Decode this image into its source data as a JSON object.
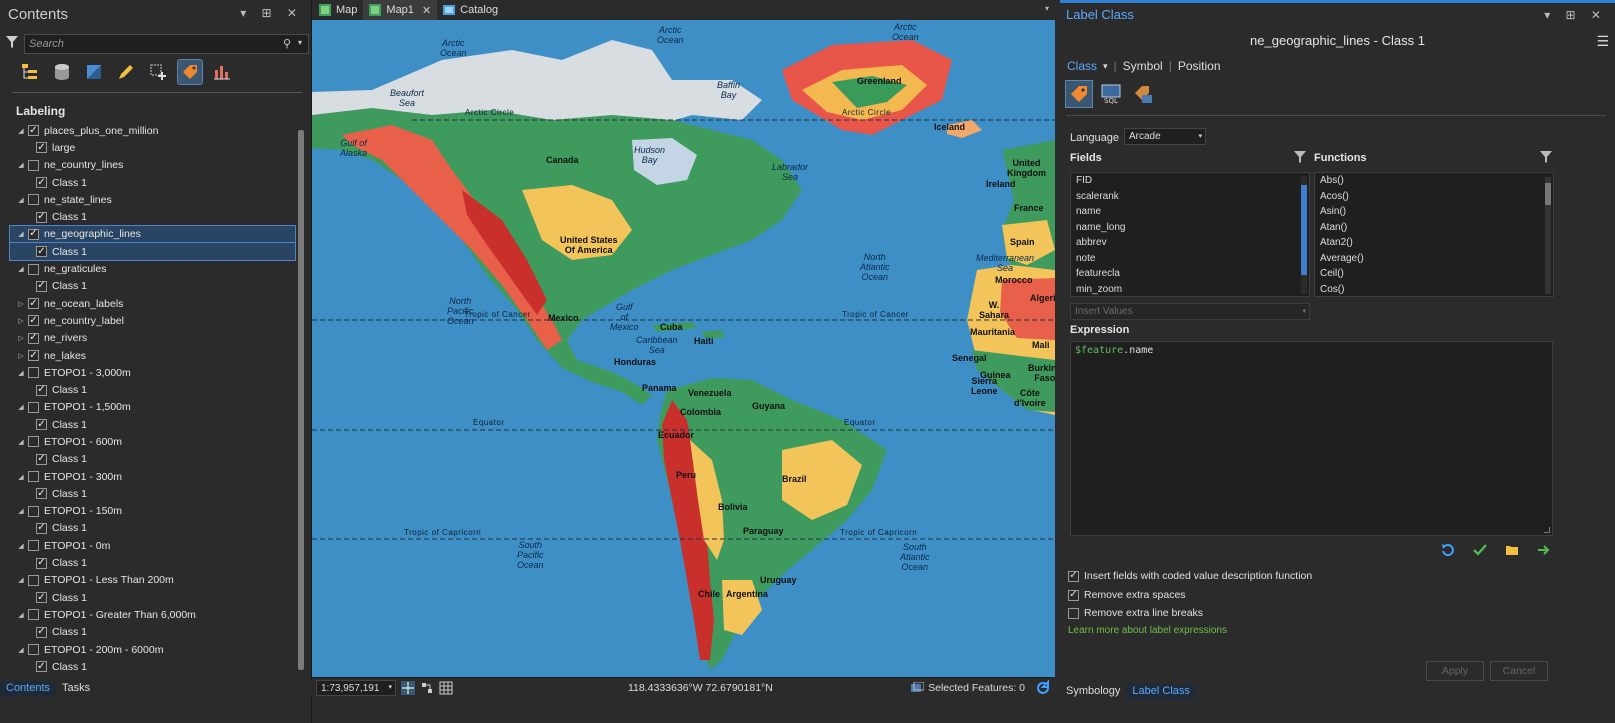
{
  "contents": {
    "title": "Contents",
    "title_controls": "▾ ⊞ ✕",
    "search_placeholder": "Search",
    "section": "Labeling",
    "layers": [
      {
        "type": "parent",
        "label": "places_plus_one_million",
        "checked": true,
        "expanded": true
      },
      {
        "type": "child",
        "label": "large",
        "checked": true
      },
      {
        "type": "parent",
        "label": "ne_country_lines",
        "checked": false,
        "expanded": true
      },
      {
        "type": "child",
        "label": "Class 1",
        "checked": true
      },
      {
        "type": "parent",
        "label": "ne_state_lines",
        "checked": false,
        "expanded": true
      },
      {
        "type": "child",
        "label": "Class 1",
        "checked": true
      },
      {
        "type": "parent",
        "label": "ne_geographic_lines",
        "checked": true,
        "expanded": true,
        "selected": true
      },
      {
        "type": "child",
        "label": "Class 1",
        "checked": true,
        "selected": true
      },
      {
        "type": "parent",
        "label": "ne_graticules",
        "checked": false,
        "expanded": true
      },
      {
        "type": "child",
        "label": "Class 1",
        "checked": true
      },
      {
        "type": "parent",
        "label": "ne_ocean_labels",
        "checked": true,
        "expanded": false
      },
      {
        "type": "parent",
        "label": "ne_country_label",
        "checked": true,
        "expanded": false
      },
      {
        "type": "parent",
        "label": "ne_rivers",
        "checked": true,
        "expanded": false
      },
      {
        "type": "parent",
        "label": "ne_lakes",
        "checked": true,
        "expanded": false
      },
      {
        "type": "parent",
        "label": "ETOPO1 - 3,000m",
        "checked": false,
        "expanded": true
      },
      {
        "type": "child",
        "label": "Class 1",
        "checked": true
      },
      {
        "type": "parent",
        "label": "ETOPO1 - 1,500m",
        "checked": false,
        "expanded": true
      },
      {
        "type": "child",
        "label": "Class 1",
        "checked": true
      },
      {
        "type": "parent",
        "label": "ETOPO1 - 600m",
        "checked": false,
        "expanded": true
      },
      {
        "type": "child",
        "label": "Class 1",
        "checked": true
      },
      {
        "type": "parent",
        "label": "ETOPO1 - 300m",
        "checked": false,
        "expanded": true
      },
      {
        "type": "child",
        "label": "Class 1",
        "checked": true
      },
      {
        "type": "parent",
        "label": "ETOPO1 - 150m",
        "checked": false,
        "expanded": true
      },
      {
        "type": "child",
        "label": "Class 1",
        "checked": true
      },
      {
        "type": "parent",
        "label": "ETOPO1 - 0m",
        "checked": false,
        "expanded": true
      },
      {
        "type": "child",
        "label": "Class 1",
        "checked": true
      },
      {
        "type": "parent",
        "label": "ETOPO1 - Less Than 200m",
        "checked": false,
        "expanded": true
      },
      {
        "type": "child",
        "label": "Class 1",
        "checked": true
      },
      {
        "type": "parent",
        "label": "ETOPO1 - Greater Than 6,000m",
        "checked": false,
        "expanded": true
      },
      {
        "type": "child",
        "label": "Class 1",
        "checked": true
      },
      {
        "type": "parent",
        "label": "ETOPO1 - 200m - 6000m",
        "checked": false,
        "expanded": true
      },
      {
        "type": "child",
        "label": "Class 1",
        "checked": true
      }
    ],
    "bottom_tabs": [
      "Contents",
      "Tasks"
    ]
  },
  "map_tabs": [
    {
      "label": "Map",
      "active": false,
      "closable": false
    },
    {
      "label": "Map1",
      "active": true,
      "closable": true
    },
    {
      "label": "Catalog",
      "active": false,
      "closable": false
    }
  ],
  "map_labels": {
    "oceans": [
      {
        "text": "Arctic\nOcean"
      },
      {
        "text": "Arctic\nOcean"
      },
      {
        "text": "Arctic\nOcean"
      },
      {
        "text": "Beaufort\nSea"
      },
      {
        "text": "Baffin\nBay"
      },
      {
        "text": "Gulf of\nAlaska"
      },
      {
        "text": "Hudson\nBay"
      },
      {
        "text": "Labrador\nSea"
      },
      {
        "text": "North\nAtlantic\nOcean"
      },
      {
        "text": "Mediterranean\nSea"
      },
      {
        "text": "North\nPacific\nOcean"
      },
      {
        "text": "Gulf\nof\nMexico"
      },
      {
        "text": "Caribbean\nSea"
      },
      {
        "text": "South\nPacific\nOcean"
      },
      {
        "text": "South\nAtlantic\nOcean"
      }
    ],
    "countries": [
      {
        "text": "Greenland"
      },
      {
        "text": "Iceland"
      },
      {
        "text": "Canada"
      },
      {
        "text": "United\nKingdom"
      },
      {
        "text": "Ireland"
      },
      {
        "text": "France"
      },
      {
        "text": "Spain"
      },
      {
        "text": "Morocco"
      },
      {
        "text": "Algeria"
      },
      {
        "text": "W.\nSahara"
      },
      {
        "text": "Mauritania"
      },
      {
        "text": "Mali"
      },
      {
        "text": "Senegal"
      },
      {
        "text": "Guinea"
      },
      {
        "text": "Burkina\nFaso"
      },
      {
        "text": "Sierra\nLeone"
      },
      {
        "text": "Côte\nd'Ivoire"
      },
      {
        "text": "United States\nOf America"
      },
      {
        "text": "Mexico"
      },
      {
        "text": "Cuba"
      },
      {
        "text": "Haiti"
      },
      {
        "text": "Honduras"
      },
      {
        "text": "Panama"
      },
      {
        "text": "Venezuela"
      },
      {
        "text": "Colombia"
      },
      {
        "text": "Guyana"
      },
      {
        "text": "Ecuador"
      },
      {
        "text": "Peru"
      },
      {
        "text": "Brazil"
      },
      {
        "text": "Bolivia"
      },
      {
        "text": "Paraguay"
      },
      {
        "text": "Uruguay"
      },
      {
        "text": "Chile"
      },
      {
        "text": "Argentina"
      }
    ],
    "lines": [
      {
        "text": "Arctic Circle"
      },
      {
        "text": "Arctic Circle"
      },
      {
        "text": "Tropic of Cancer"
      },
      {
        "text": "Tropic of Cancer"
      },
      {
        "text": "Equator"
      },
      {
        "text": "Equator"
      },
      {
        "text": "Tropic of Capricorn"
      },
      {
        "text": "Tropic of Capricorn"
      }
    ]
  },
  "status": {
    "scale": "1:73,957,191",
    "coords": "118.4333636°W 72.6790181°N",
    "selected_features": "Selected Features: 0"
  },
  "label_class": {
    "title": "Label Class",
    "title_controls": "▾ ⊞ ✕",
    "subtitle": "ne_geographic_lines - Class 1",
    "nav": {
      "class": "Class",
      "symbol": "Symbol",
      "position": "Position"
    },
    "language_label": "Language",
    "language_value": "Arcade",
    "fields_header": "Fields",
    "functions_header": "Functions",
    "fields": [
      "FID",
      "scalerank",
      "name",
      "name_long",
      "abbrev",
      "note",
      "featurecla",
      "min_zoom"
    ],
    "functions": [
      "Abs()",
      "Acos()",
      "Asin()",
      "Atan()",
      "Atan2()",
      "Average()",
      "Ceil()",
      "Cos()"
    ],
    "insert_values_placeholder": "Insert Values",
    "expression_header": "Expression",
    "expression_keyword": "$feature",
    "expression_rest": ".name",
    "options": [
      {
        "label": "Insert fields with coded value description function",
        "checked": true
      },
      {
        "label": "Remove extra spaces",
        "checked": true
      },
      {
        "label": "Remove extra line breaks",
        "checked": false
      }
    ],
    "learn_more": "Learn more about label expressions",
    "apply": "Apply",
    "cancel": "Cancel",
    "bottom_tabs": [
      "Symbology",
      "Label Class"
    ]
  }
}
